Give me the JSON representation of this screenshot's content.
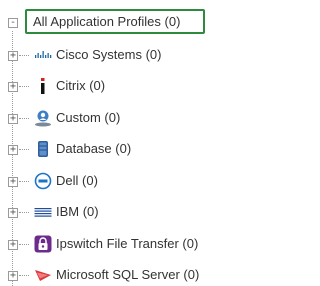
{
  "tree": {
    "root": {
      "label": "All Application Profiles (0)",
      "toggle": "-"
    },
    "items": [
      {
        "label": "Cisco Systems (0)",
        "icon": "cisco-logo-icon",
        "toggle": "+"
      },
      {
        "label": "Citrix (0)",
        "icon": "citrix-logo-icon",
        "toggle": "+"
      },
      {
        "label": "Custom (0)",
        "icon": "custom-profile-icon",
        "toggle": "+"
      },
      {
        "label": "Database (0)",
        "icon": "database-icon",
        "toggle": "+"
      },
      {
        "label": "Dell (0)",
        "icon": "dell-logo-icon",
        "toggle": "+"
      },
      {
        "label": "IBM (0)",
        "icon": "ibm-logo-icon",
        "toggle": "+"
      },
      {
        "label": "Ipswitch File Transfer (0)",
        "icon": "ipswitch-logo-icon",
        "toggle": "+"
      },
      {
        "label": "Microsoft SQL Server (0)",
        "icon": "microsoft-sql-server-icon",
        "toggle": "+"
      }
    ]
  },
  "colors": {
    "highlight_border": "#2e8b3e",
    "tree_line": "#9a9a9a",
    "text": "#333333"
  }
}
